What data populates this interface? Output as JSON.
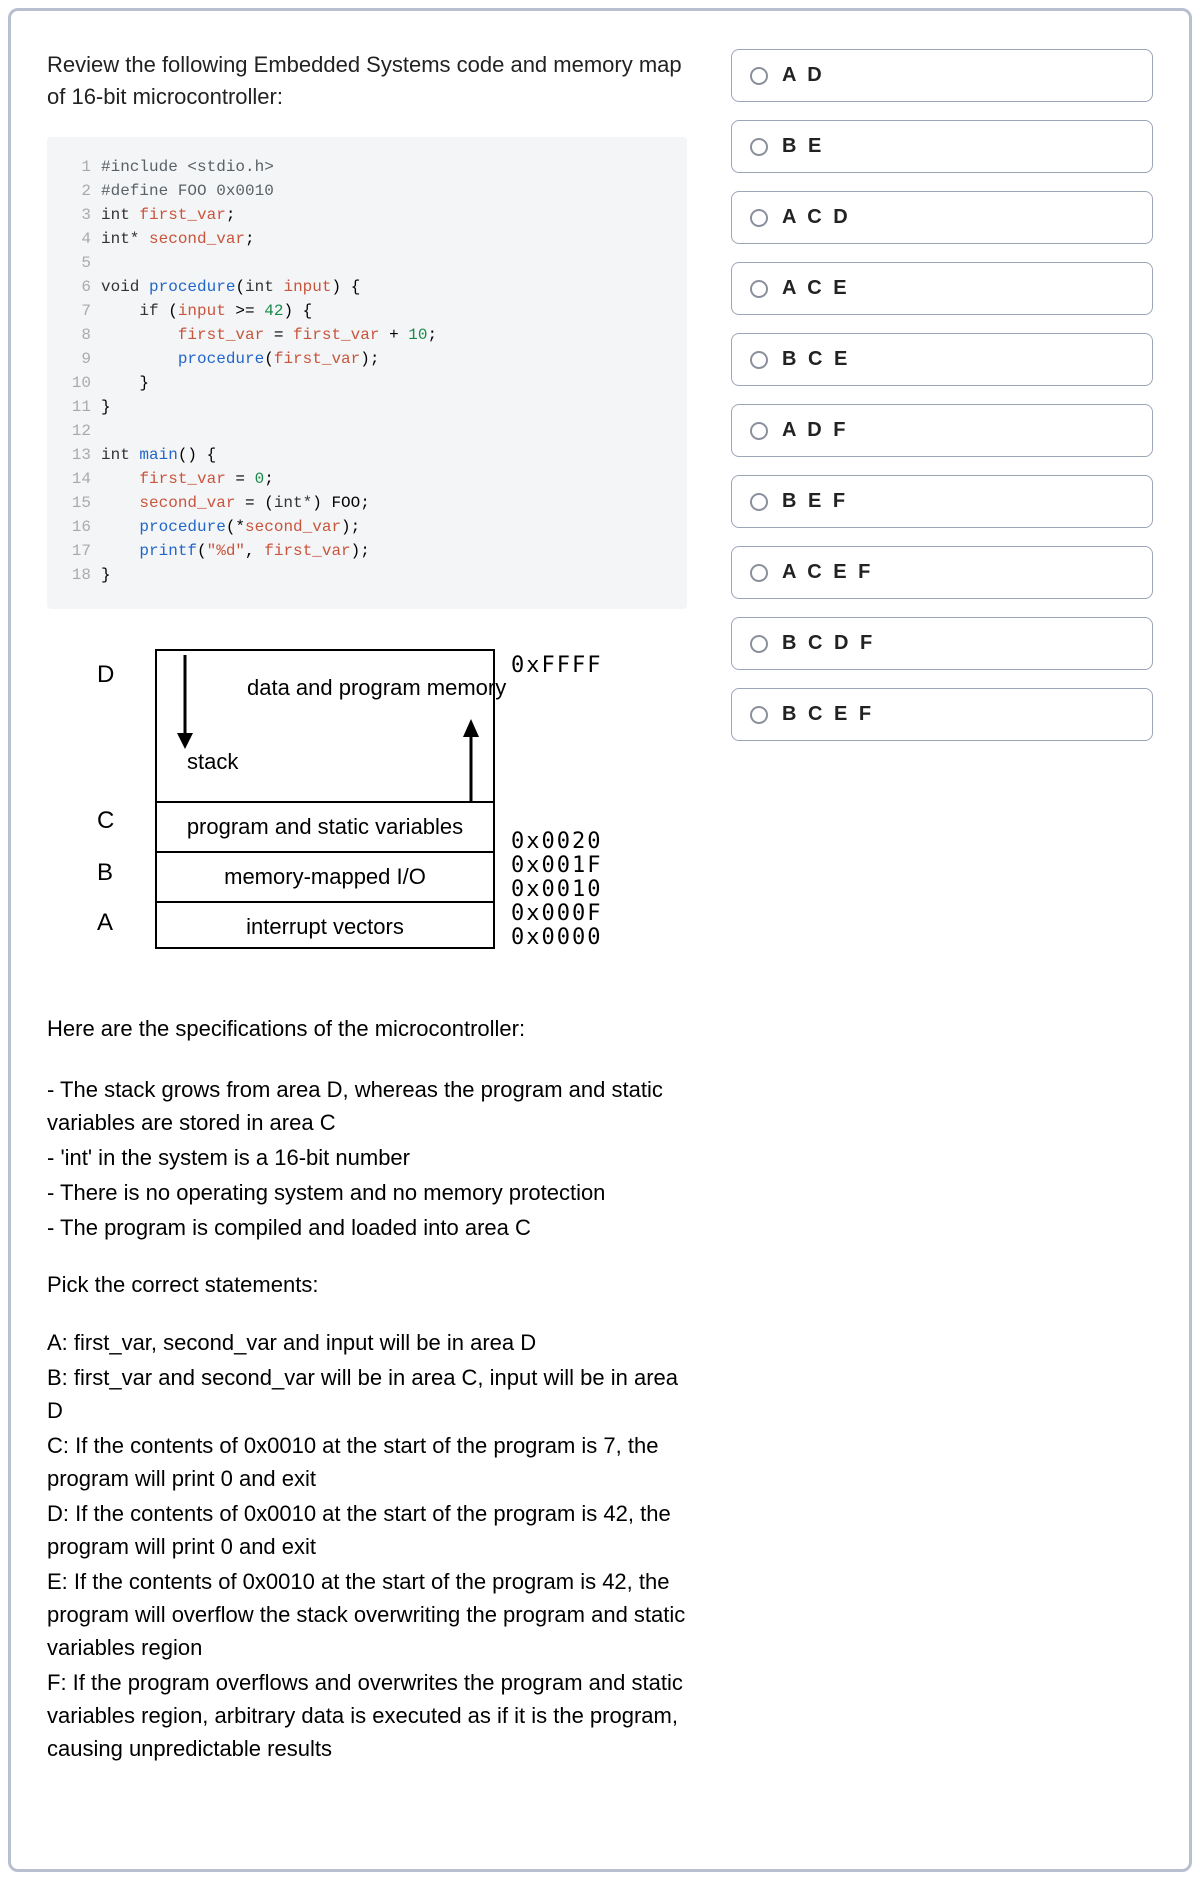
{
  "question": {
    "intro": "Review the following Embedded Systems code and memory map of 16-bit microcontroller:",
    "spec_heading": "Here are the specifications of the microcontroller:",
    "specs": [
      "- The stack grows from area D, whereas the program and static variables are stored in area C",
      "- 'int' in the system is a 16-bit number",
      "- There is no operating system and no memory protection",
      "- The program is compiled and loaded into area C"
    ],
    "pick": "Pick the correct statements:",
    "statements": [
      "A: first_var, second_var and input will be in area D",
      "B: first_var and second_var will be in area C, input will be in area D",
      "C: If the contents of 0x0010 at the start of the program is 7, the program will print 0 and exit",
      "D: If the contents of 0x0010 at the start of the program is 42, the program will print 0 and exit",
      "E: If the contents of 0x0010 at the start of the program is 42, the program will overflow the stack overwriting the program and static variables region",
      "F: If the program overflows and overwrites the program and static variables region, arbitrary data is executed as if it is the program, causing unpredictable results"
    ]
  },
  "code": {
    "lines": [
      {
        "n": "1",
        "html": "<span class='tok-pre'>#include</span> <span class='tok-pre'>&lt;stdio.h&gt;</span>"
      },
      {
        "n": "2",
        "html": "<span class='tok-pre'>#define FOO 0x0010</span>"
      },
      {
        "n": "3",
        "html": "<span class='tok-type'>int</span> <span class='tok-var'>first_var</span>;"
      },
      {
        "n": "4",
        "html": "<span class='tok-type'>int*</span> <span class='tok-var'>second_var</span>;"
      },
      {
        "n": "5",
        "html": ""
      },
      {
        "n": "6",
        "html": "<span class='tok-type'>void</span> <span class='tok-fn'>procedure</span>(<span class='tok-type'>int</span> <span class='tok-var'>input</span>) {"
      },
      {
        "n": "7",
        "html": "    <span class='tok-kw'>if</span> (<span class='tok-var'>input</span> &gt;= <span class='tok-num'>42</span>) {"
      },
      {
        "n": "8",
        "html": "        <span class='tok-var'>first_var</span> = <span class='tok-var'>first_var</span> + <span class='tok-num'>10</span>;"
      },
      {
        "n": "9",
        "html": "        <span class='tok-fn'>procedure</span>(<span class='tok-var'>first_var</span>);"
      },
      {
        "n": "10",
        "html": "    }"
      },
      {
        "n": "11",
        "html": "}"
      },
      {
        "n": "12",
        "html": ""
      },
      {
        "n": "13",
        "html": "<span class='tok-type'>int</span> <span class='tok-fn'>main</span>() {"
      },
      {
        "n": "14",
        "html": "    <span class='tok-var'>first_var</span> = <span class='tok-num'>0</span>;"
      },
      {
        "n": "15",
        "html": "    <span class='tok-var'>second_var</span> = (<span class='tok-type'>int*</span>) FOO;"
      },
      {
        "n": "16",
        "html": "    <span class='tok-fn'>procedure</span>(*<span class='tok-var'>second_var</span>);"
      },
      {
        "n": "17",
        "html": "    <span class='tok-fn'>printf</span>(<span class='tok-str'>\"%d\"</span>, <span class='tok-var'>first_var</span>);"
      },
      {
        "n": "18",
        "html": "}"
      }
    ]
  },
  "memory_map": {
    "region_D": "D",
    "region_C": "C",
    "region_B": "B",
    "region_A": "A",
    "top_text": "data and program memory",
    "stack_text": "stack",
    "row2_text": "program and static variables",
    "row3_text": "memory-mapped I/O",
    "row4_text": "interrupt vectors",
    "addr_top": "0xFFFF",
    "addr_0020": "0x0020",
    "addr_001F": "0x001F",
    "addr_0010": "0x0010",
    "addr_000F": "0x000F",
    "addr_0000": "0x0000"
  },
  "options": [
    {
      "label": "A D"
    },
    {
      "label": "B E"
    },
    {
      "label": "A C D"
    },
    {
      "label": "A C E"
    },
    {
      "label": "B C E"
    },
    {
      "label": "A D F"
    },
    {
      "label": "B E F"
    },
    {
      "label": "A C E F"
    },
    {
      "label": "B C D F"
    },
    {
      "label": "B C E F"
    }
  ]
}
